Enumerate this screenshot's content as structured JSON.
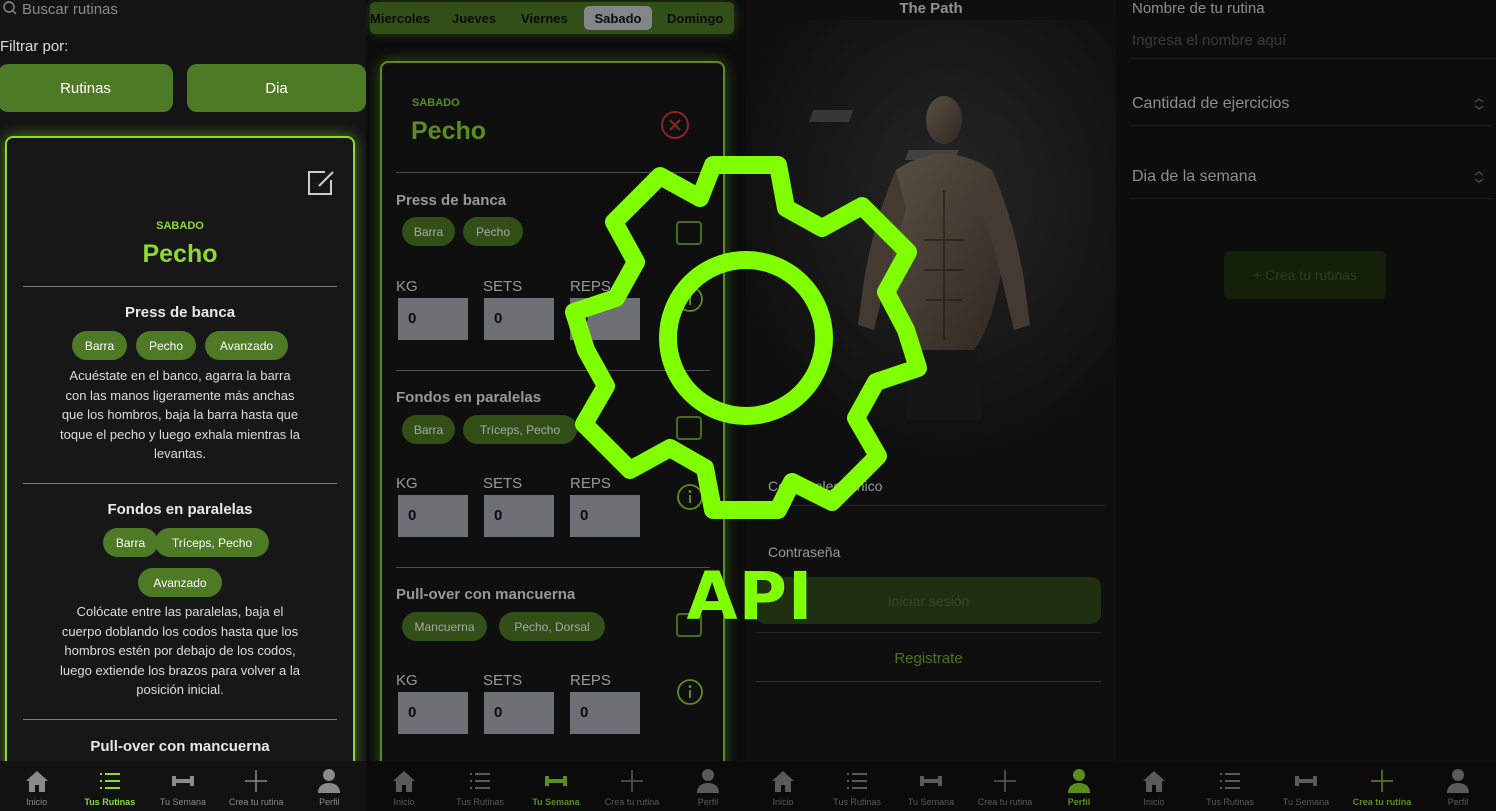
{
  "colors": {
    "accent": "#8dd92f",
    "pill": "#4e7a25",
    "card_border": "#8dd92f",
    "api_green": "#7fff00"
  },
  "screen1": {
    "search_placeholder": "Buscar rutinas",
    "filter_label": "Filtrar por:",
    "filter_buttons": [
      "Rutinas",
      "Dia"
    ],
    "card": {
      "day": "SABADO",
      "title": "Pecho",
      "exercises": [
        {
          "name": "Press de banca",
          "tags": [
            "Barra",
            "Pecho",
            "Avanzado"
          ],
          "desc": [
            "Acuéstate en el banco, agarra la barra",
            "con las manos ligeramente más anchas",
            "que los hombros, baja la barra hasta que",
            "toque el pecho y luego exhala mientras la",
            "levantas."
          ]
        },
        {
          "name": "Fondos en paralelas",
          "tags": [
            "Barra",
            "Tríceps, Pecho",
            "Avanzado"
          ],
          "desc": [
            "Colócate entre las paralelas, baja el",
            "cuerpo doblando los codos hasta que los",
            "hombros estén por debajo de los codos,",
            "luego extiende los brazos para volver a la",
            "posición inicial."
          ]
        },
        {
          "name": "Pull-over con mancuerna"
        }
      ]
    },
    "nav": [
      "Inicio",
      "Tus Rutinas",
      "Tu Semana",
      "Crea tu rutina",
      "Perfil"
    ]
  },
  "screen2": {
    "days": [
      "Miercoles",
      "Jueves",
      "Viernes",
      "Sabado",
      "Domingo"
    ],
    "selected_day": "Sabado",
    "card": {
      "day": "SABADO",
      "title": "Pecho",
      "exercises": [
        {
          "name": "Press de banca",
          "tags": [
            "Barra",
            "Pecho"
          ],
          "kg": "0",
          "sets": "0",
          "reps": "0"
        },
        {
          "name": "Fondos en paralelas",
          "tags": [
            "Barra",
            "Tríceps, Pecho"
          ],
          "kg": "0",
          "sets": "0",
          "reps": "0"
        },
        {
          "name": "Pull-over con mancuerna",
          "tags": [
            "Mancuerna",
            "Pecho, Dorsal"
          ],
          "kg": "0",
          "sets": "0",
          "reps": "0"
        }
      ],
      "labels": {
        "kg": "KG",
        "sets": "SETS",
        "reps": "REPS"
      }
    },
    "nav": [
      "Inicio",
      "Tus Rutinas",
      "Tu Semana",
      "Crea tu rutina",
      "Perfil"
    ]
  },
  "screen3": {
    "title": "The Path",
    "email_label": "Correo electrónico",
    "password_label": "Contraseña",
    "login_button": "Iniciar sesión",
    "register_link": "Registrate",
    "nav": [
      "Inicio",
      "Tus Rutinas",
      "Tu Semana",
      "Crea tu rutina",
      "Perfil"
    ]
  },
  "screen4": {
    "name_label": "Nombre de tu rutina",
    "name_placeholder": "Ingresa el nombre aquí",
    "exercises_select": "Cantidad de ejercicios",
    "day_select": "Dia de la semana",
    "create_button": "+ Crea tu rutinas",
    "nav": [
      "Inicio",
      "Tus Rutinas",
      "Tu Semana",
      "Crea tu rutina",
      "Perfil"
    ]
  },
  "overlay": {
    "label": "API",
    "icon": "gear-icon"
  }
}
